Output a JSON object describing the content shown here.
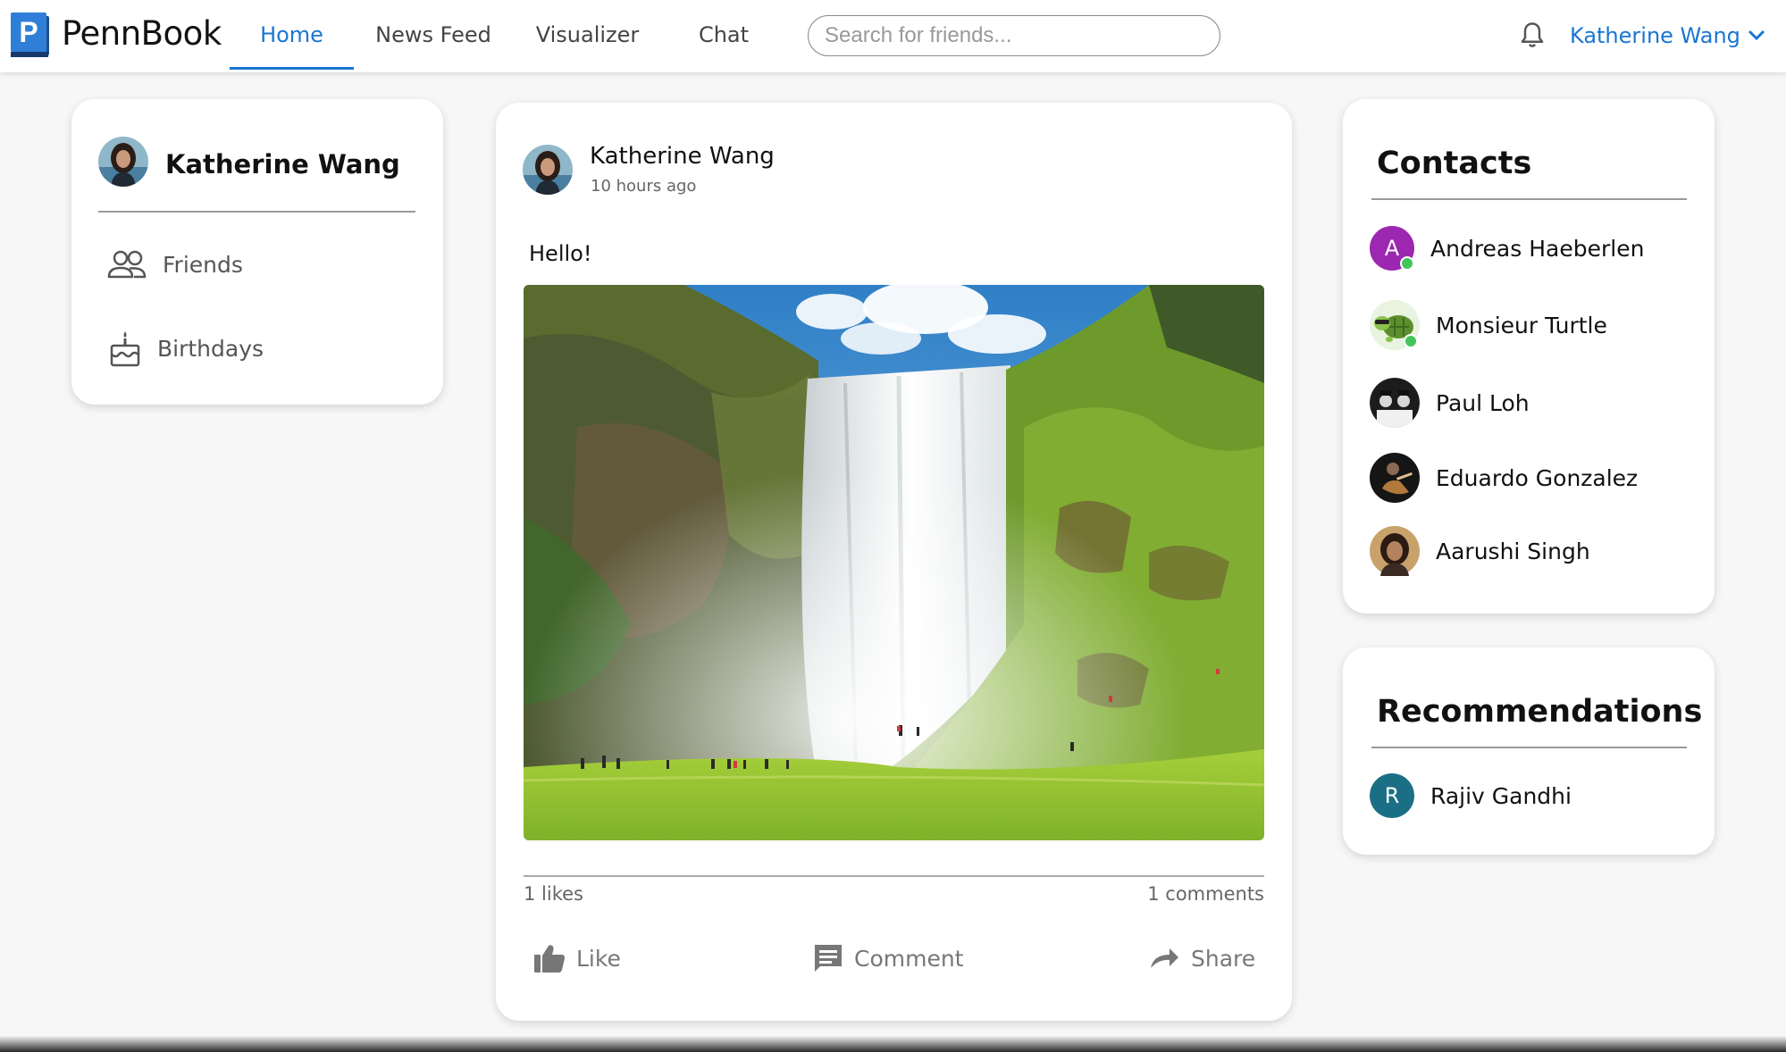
{
  "app": {
    "brand": "PennBook",
    "logo_letter": "P"
  },
  "nav": {
    "tabs": [
      {
        "label": "Home",
        "active": true
      },
      {
        "label": "News Feed",
        "active": false
      },
      {
        "label": "Visualizer",
        "active": false
      },
      {
        "label": "Chat",
        "active": false
      }
    ],
    "search_placeholder": "Search for friends...",
    "user_name": "Katherine Wang"
  },
  "profile": {
    "name": "Katherine Wang",
    "items": [
      {
        "label": "Friends",
        "icon": "people-icon"
      },
      {
        "label": "Birthdays",
        "icon": "cake-icon"
      }
    ]
  },
  "post": {
    "author": "Katherine Wang",
    "time": "10 hours ago",
    "text": "Hello!",
    "photo": "waterfall-photo",
    "likes": "1 likes",
    "comments": "1 comments",
    "actions": {
      "like": "Like",
      "comment": "Comment",
      "share": "Share"
    }
  },
  "contacts": {
    "title": "Contacts",
    "people": [
      {
        "name": "Andreas Haeberlen",
        "avatar_letter": "A",
        "avatar_color": "#9c27b0",
        "online": true
      },
      {
        "name": "Monsieur Turtle",
        "avatar": "turtle",
        "online": true
      },
      {
        "name": "Paul Loh",
        "avatar": "photo"
      },
      {
        "name": "Eduardo Gonzalez",
        "avatar": "photo"
      },
      {
        "name": "Aarushi Singh",
        "avatar": "photo"
      }
    ]
  },
  "recommendations": {
    "title": "Recommendations",
    "people": [
      {
        "name": "Rajiv Gandhi",
        "avatar_letter": "R",
        "avatar_color": "#1b6f85"
      }
    ]
  },
  "colors": {
    "accent": "#1976d2",
    "online": "#44c55a"
  }
}
